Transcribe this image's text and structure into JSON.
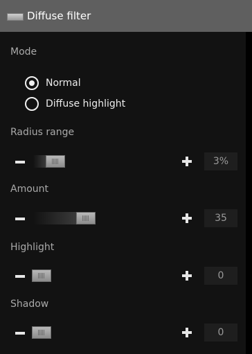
{
  "panel": {
    "title": "Diffuse filter",
    "icon": "panel-toggle-icon"
  },
  "mode": {
    "label": "Mode",
    "options": [
      {
        "label": "Normal",
        "selected": true
      },
      {
        "label": "Diffuse highlight",
        "selected": false
      }
    ]
  },
  "sliders": {
    "radius": {
      "label": "Radius range",
      "value": "3%",
      "level": 0.03
    },
    "amount": {
      "label": "Amount",
      "value": "35",
      "level": 0.35
    },
    "highlight": {
      "label": "Highlight",
      "value": "0",
      "level": 0
    },
    "shadow": {
      "label": "Shadow",
      "value": "0",
      "level": 0
    }
  },
  "colors": {
    "header_bg": "#5f5f5f",
    "panel_bg": "#121212",
    "value_box_bg": "#1e1e1e",
    "label_text": "#a9a9a9"
  }
}
